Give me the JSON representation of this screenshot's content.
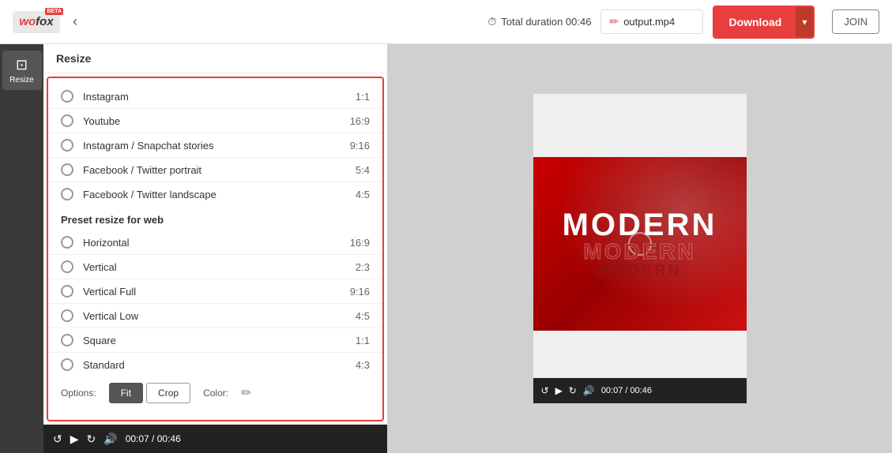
{
  "header": {
    "logo_text": "wofox",
    "logo_badge": "BETA",
    "back_icon": "‹",
    "duration_label": "Total duration 00:46",
    "duration_icon": "⏱",
    "filename": "output.mp4",
    "edit_icon": "✏",
    "download_label": "Download",
    "dropdown_icon": "▾",
    "join_label": "JOIN"
  },
  "sidebar": {
    "resize_label": "Resize",
    "resize_icon": "⊞"
  },
  "resize_panel": {
    "title": "Resize",
    "options": [
      {
        "label": "Instagram",
        "ratio": "1:1"
      },
      {
        "label": "Youtube",
        "ratio": "16:9"
      },
      {
        "label": "Instagram / Snapchat stories",
        "ratio": "9:16"
      },
      {
        "label": "Facebook / Twitter portrait",
        "ratio": "5:4"
      },
      {
        "label": "Facebook / Twitter landscape",
        "ratio": "4:5"
      }
    ],
    "web_heading": "Preset resize for web",
    "web_options": [
      {
        "label": "Horizontal",
        "ratio": "16:9"
      },
      {
        "label": "Vertical",
        "ratio": "2:3"
      },
      {
        "label": "Vertical Full",
        "ratio": "9:16"
      },
      {
        "label": "Vertical Low",
        "ratio": "4:5"
      },
      {
        "label": "Square",
        "ratio": "1:1"
      },
      {
        "label": "Standard",
        "ratio": "4:3"
      }
    ],
    "options_label": "Options:",
    "color_label": "Color:",
    "fit_btn": "Fit",
    "crop_btn": "Crop",
    "color_icon": "✏"
  },
  "transport": {
    "restart_icon": "↺",
    "play_icon": "▶",
    "loop_icon": "↻",
    "volume_icon": "🔊",
    "time": "00:07 / 00:46"
  },
  "preview": {
    "modern_main": "MODERN",
    "modern_echo1": "MODERN",
    "modern_echo2": "MODERN",
    "transport_restart": "↺",
    "transport_play": "▶",
    "transport_loop": "↻",
    "transport_volume": "🔊",
    "transport_time": "00:07 / 00:46"
  }
}
